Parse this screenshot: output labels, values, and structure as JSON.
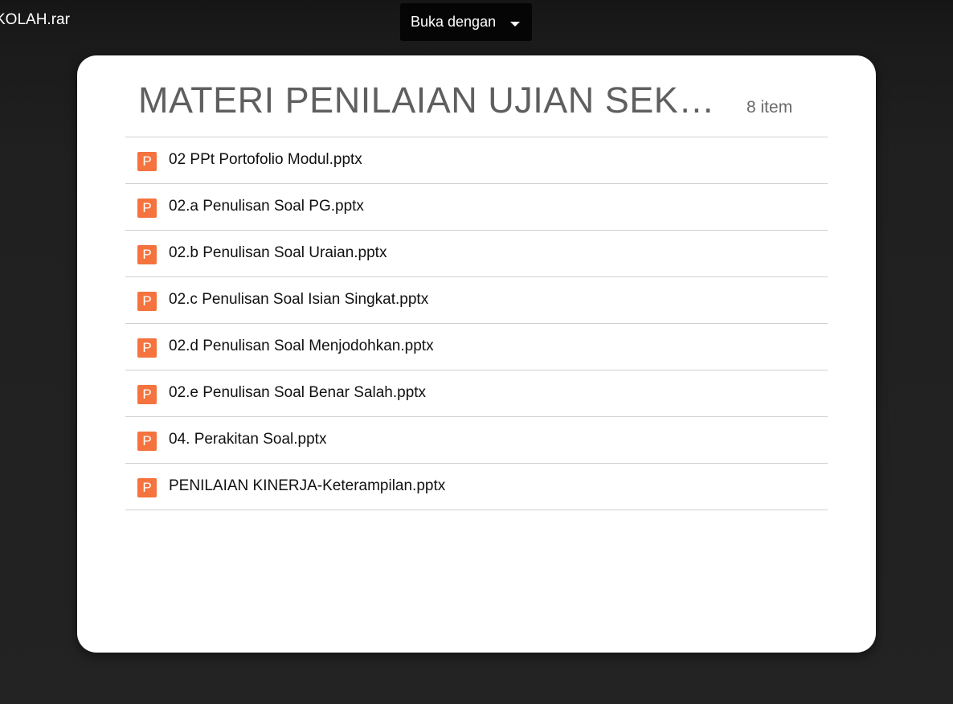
{
  "topbar": {
    "filename": "KOLAH.rar",
    "open_with_label": "Buka dengan"
  },
  "folder": {
    "title": "MATERI PENILAIAN UJIAN SEKOLAH",
    "item_count": "8 item"
  },
  "files": [
    {
      "name": "02 PPt Portofolio Modul.pptx",
      "icon": "powerpoint-icon",
      "icon_letter": "P"
    },
    {
      "name": "02.a Penulisan Soal PG.pptx",
      "icon": "powerpoint-icon",
      "icon_letter": "P"
    },
    {
      "name": "02.b Penulisan Soal Uraian.pptx",
      "icon": "powerpoint-icon",
      "icon_letter": "P"
    },
    {
      "name": "02.c Penulisan Soal Isian Singkat.pptx",
      "icon": "powerpoint-icon",
      "icon_letter": "P"
    },
    {
      "name": "02.d Penulisan Soal Menjodohkan.pptx",
      "icon": "powerpoint-icon",
      "icon_letter": "P"
    },
    {
      "name": "02.e Penulisan Soal Benar Salah.pptx",
      "icon": "powerpoint-icon",
      "icon_letter": "P"
    },
    {
      "name": "04. Perakitan Soal.pptx",
      "icon": "powerpoint-icon",
      "icon_letter": "P"
    },
    {
      "name": "PENILAIAN KINERJA-Keterampilan.pptx",
      "icon": "powerpoint-icon",
      "icon_letter": "P"
    }
  ],
  "colors": {
    "powerpoint_icon": "#f4733e",
    "background": "#1f1f1f",
    "card": "#ffffff",
    "button": "#050505"
  }
}
